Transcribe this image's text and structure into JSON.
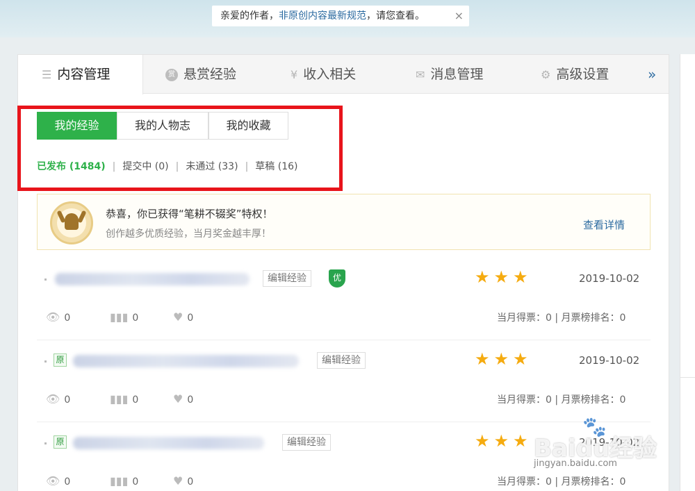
{
  "notice": {
    "prefix": "亲爱的作者，",
    "link": "非原创内容最新规范",
    "suffix": "，请您查看。",
    "close": "×"
  },
  "tabs": [
    {
      "label": "内容管理",
      "icon": "list-icon",
      "active": true
    },
    {
      "label": "悬赏经验",
      "icon": "reward-coin-icon"
    },
    {
      "label": "收入相关",
      "icon": "yen-icon"
    },
    {
      "label": "消息管理",
      "icon": "mail-icon"
    },
    {
      "label": "高级设置",
      "icon": "gear-icon"
    }
  ],
  "more": "»",
  "subtabs": [
    {
      "label": "我的经验",
      "active": true
    },
    {
      "label": "我的人物志"
    },
    {
      "label": "我的收藏"
    }
  ],
  "filters": [
    {
      "label": "已发布 (1484)",
      "active": true
    },
    {
      "label": "提交中 (0)"
    },
    {
      "label": "未通过 (33)"
    },
    {
      "label": "草稿 (16)"
    }
  ],
  "promo": {
    "title": "恭喜，你已获得“笔耕不辍奖”特权！",
    "subtitle": "创作越多优质经验，当月奖金越丰厚！",
    "link": "查看详情"
  },
  "items": [
    {
      "edit": "编辑经验",
      "badge": "优",
      "stars": "★★★",
      "rating": 3,
      "date": "2019-10-02",
      "views": "0",
      "votes": "0",
      "likes": "0",
      "monthly": "当月得票：0 | 月票榜排名：0"
    },
    {
      "original": "原",
      "edit": "编辑经验",
      "stars": "★★★",
      "rating": 3,
      "date": "2019-10-02",
      "views": "0",
      "votes": "0",
      "likes": "0",
      "monthly": "当月得票：0 | 月票榜排名：0"
    },
    {
      "original": "原",
      "edit": "编辑经验",
      "stars": "★★★",
      "rating": 3,
      "date": "2019-10-02",
      "views": "0",
      "votes": "0",
      "likes": "0",
      "monthly": "当月得票：0 | 月票榜排名：0"
    }
  ],
  "watermark": {
    "brand": "Baidu经验",
    "url": "jingyan.baidu.com"
  },
  "colors": {
    "accent": "#2eb14a",
    "link": "#2b6aa0",
    "star": "#f5ab10",
    "highlight_box": "#e8141b"
  }
}
